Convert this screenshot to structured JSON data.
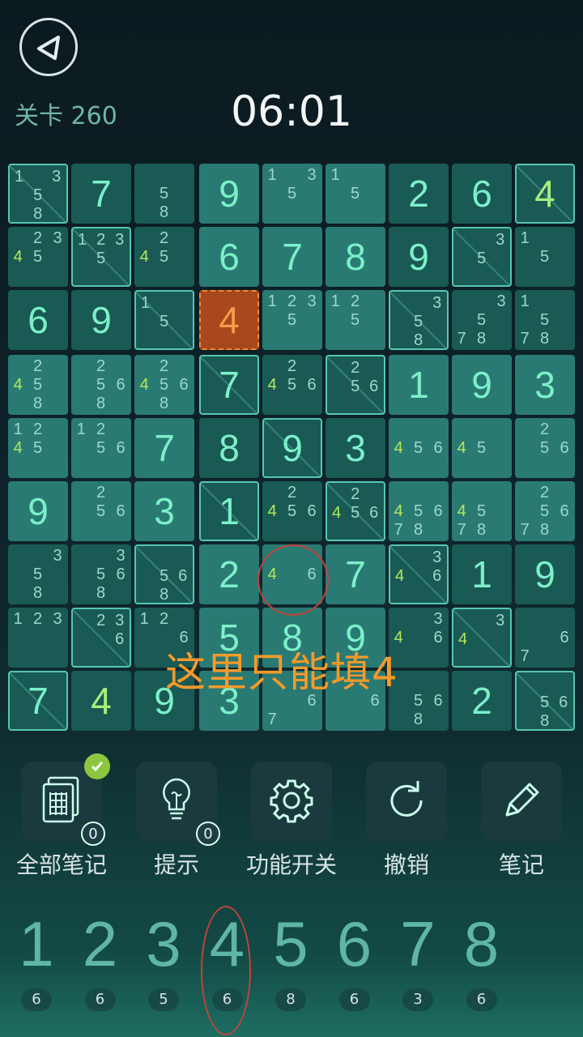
{
  "header": {
    "level_label": "关卡 260",
    "timer": "06:01"
  },
  "overlay_hint": "这里只能填4",
  "board": [
    [
      {
        "n": [
          "1",
          "",
          "3",
          "",
          "5",
          "",
          "",
          "8",
          ""
        ],
        "f": 1
      },
      {
        "v": "7"
      },
      {
        "n": [
          "",
          "",
          "",
          "",
          "5",
          "",
          "",
          "8",
          ""
        ]
      },
      {
        "v": "9"
      },
      {
        "n": [
          "1",
          "",
          "3",
          "",
          "5",
          "",
          "",
          "",
          ""
        ]
      },
      {
        "n": [
          "1",
          "",
          "",
          "",
          "5",
          "",
          "",
          "",
          ""
        ]
      },
      {
        "v": "2"
      },
      {
        "v": "6"
      },
      {
        "v": "4",
        "c": "green",
        "f": 1
      }
    ],
    [
      {
        "n": [
          "",
          "2",
          "3",
          "4",
          "5",
          "",
          "",
          "",
          ""
        ],
        "g": [
          3
        ]
      },
      {
        "n": [
          "1",
          "2",
          "3",
          "",
          "5",
          "",
          "",
          "",
          ""
        ],
        "f": 1
      },
      {
        "n": [
          "",
          "2",
          "",
          "4",
          "5",
          "",
          "",
          "",
          ""
        ],
        "g": [
          3
        ]
      },
      {
        "v": "6"
      },
      {
        "v": "7"
      },
      {
        "v": "8"
      },
      {
        "v": "9"
      },
      {
        "n": [
          "",
          "",
          "3",
          "",
          "5",
          "",
          "",
          "",
          ""
        ],
        "f": 1
      },
      {
        "n": [
          "1",
          "",
          "",
          "",
          "5",
          "",
          "",
          "",
          ""
        ]
      }
    ],
    [
      {
        "v": "6"
      },
      {
        "v": "9"
      },
      {
        "n": [
          "1",
          "",
          "",
          "",
          "5",
          "",
          "",
          "",
          ""
        ],
        "f": 1
      },
      {
        "v": "4",
        "c": "orange",
        "sel": 1
      },
      {
        "n": [
          "1",
          "2",
          "3",
          "",
          "5",
          "",
          "",
          "",
          ""
        ]
      },
      {
        "n": [
          "1",
          "2",
          "",
          "",
          "5",
          "",
          "",
          "",
          ""
        ]
      },
      {
        "n": [
          "",
          "",
          "3",
          "",
          "5",
          "",
          "",
          "8",
          ""
        ],
        "f": 1
      },
      {
        "n": [
          "",
          "",
          "3",
          "",
          "5",
          "",
          "7",
          "8",
          ""
        ]
      },
      {
        "n": [
          "1",
          "",
          "",
          "",
          "5",
          "",
          "7",
          "8",
          ""
        ]
      }
    ],
    [
      {
        "n": [
          "",
          "2",
          "",
          "4",
          "5",
          "",
          "",
          "8",
          ""
        ],
        "g": [
          3
        ]
      },
      {
        "n": [
          "",
          "2",
          "",
          "",
          "5",
          "6",
          "",
          "8",
          ""
        ]
      },
      {
        "n": [
          "",
          "2",
          "",
          "4",
          "5",
          "6",
          "",
          "8",
          ""
        ],
        "g": [
          3
        ]
      },
      {
        "v": "7",
        "f": 1
      },
      {
        "n": [
          "",
          "2",
          "",
          "4",
          "5",
          "6",
          "",
          "",
          ""
        ],
        "g": [
          3
        ]
      },
      {
        "n": [
          "",
          "2",
          "",
          "",
          "5",
          "6",
          "",
          "",
          ""
        ],
        "f": 1
      },
      {
        "v": "1"
      },
      {
        "v": "9"
      },
      {
        "v": "3"
      }
    ],
    [
      {
        "n": [
          "1",
          "2",
          "",
          "4",
          "5",
          "",
          "",
          "",
          ""
        ],
        "g": [
          3
        ]
      },
      {
        "n": [
          "1",
          "2",
          "",
          "",
          "5",
          "6",
          "",
          "",
          ""
        ]
      },
      {
        "v": "7"
      },
      {
        "v": "8"
      },
      {
        "v": "9",
        "f": 1
      },
      {
        "v": "3"
      },
      {
        "n": [
          "",
          "",
          "",
          "4",
          "5",
          "6",
          "",
          "",
          ""
        ],
        "g": [
          3
        ]
      },
      {
        "n": [
          "",
          "",
          "",
          "4",
          "5",
          "",
          "",
          "",
          ""
        ],
        "g": [
          3
        ]
      },
      {
        "n": [
          "",
          "2",
          "",
          "",
          "5",
          "6",
          "",
          "",
          ""
        ]
      }
    ],
    [
      {
        "v": "9"
      },
      {
        "n": [
          "",
          "2",
          "",
          "",
          "5",
          "6",
          "",
          "",
          ""
        ]
      },
      {
        "v": "3"
      },
      {
        "v": "1",
        "f": 1
      },
      {
        "n": [
          "",
          "2",
          "",
          "4",
          "5",
          "6",
          "",
          "",
          ""
        ],
        "g": [
          3
        ]
      },
      {
        "n": [
          "",
          "2",
          "",
          "4",
          "5",
          "6",
          "",
          "",
          ""
        ],
        "g": [
          3
        ],
        "f": 1
      },
      {
        "n": [
          "",
          "",
          "",
          "4",
          "5",
          "6",
          "7",
          "8",
          ""
        ],
        "g": [
          3
        ]
      },
      {
        "n": [
          "",
          "",
          "",
          "4",
          "5",
          "",
          "7",
          "8",
          ""
        ],
        "g": [
          3
        ]
      },
      {
        "n": [
          "",
          "2",
          "",
          "",
          "5",
          "6",
          "7",
          "8",
          ""
        ]
      }
    ],
    [
      {
        "n": [
          "",
          "",
          "3",
          "",
          "5",
          "",
          "",
          "8",
          ""
        ]
      },
      {
        "n": [
          "",
          "",
          "3",
          "",
          "5",
          "6",
          "",
          "8",
          ""
        ]
      },
      {
        "n": [
          "",
          "",
          "",
          "",
          "5",
          "6",
          "",
          "8",
          ""
        ],
        "f": 1
      },
      {
        "v": "2"
      },
      {
        "n": [
          "",
          "",
          "",
          "4",
          "",
          "6",
          "",
          "",
          ""
        ],
        "g": [
          3
        ]
      },
      {
        "v": "7"
      },
      {
        "n": [
          "",
          "",
          "3",
          "4",
          "",
          "6",
          "",
          "",
          ""
        ],
        "g": [
          3
        ],
        "f": 1
      },
      {
        "v": "1"
      },
      {
        "v": "9"
      }
    ],
    [
      {
        "n": [
          "1",
          "2",
          "3",
          "",
          "",
          "",
          "",
          "",
          ""
        ]
      },
      {
        "n": [
          "",
          "2",
          "3",
          "",
          "",
          "6",
          "",
          "",
          ""
        ],
        "f": 1
      },
      {
        "n": [
          "1",
          "2",
          "",
          "",
          "",
          "6",
          "",
          "",
          ""
        ]
      },
      {
        "v": "5"
      },
      {
        "v": "8"
      },
      {
        "v": "9"
      },
      {
        "n": [
          "",
          "",
          "3",
          "4",
          "",
          "6",
          "",
          "",
          ""
        ],
        "g": [
          3
        ]
      },
      {
        "n": [
          "",
          "",
          "3",
          "4",
          "",
          "",
          "",
          "",
          ""
        ],
        "g": [
          3
        ],
        "f": 1
      },
      {
        "n": [
          "",
          "",
          "",
          "",
          "",
          "6",
          "7",
          "",
          ""
        ]
      }
    ],
    [
      {
        "v": "7",
        "f": 1
      },
      {
        "v": "4",
        "c": "green"
      },
      {
        "v": "9"
      },
      {
        "v": "3"
      },
      {
        "n": [
          "",
          "",
          "",
          "",
          "",
          "6",
          "7",
          "",
          ""
        ]
      },
      {
        "n": [
          "",
          "",
          "",
          "",
          "",
          "6",
          "",
          "",
          ""
        ]
      },
      {
        "n": [
          "",
          "",
          "",
          "",
          "5",
          "6",
          "",
          "8",
          ""
        ]
      },
      {
        "v": "2"
      },
      {
        "n": [
          "",
          "",
          "",
          "",
          "5",
          "6",
          "",
          "8",
          ""
        ],
        "f": 1
      }
    ]
  ],
  "tools": [
    {
      "label": "全部笔记",
      "icon": "notes-grid-icon",
      "count": "0",
      "checked": true
    },
    {
      "label": "提示",
      "icon": "lightbulb-icon",
      "count": "0"
    },
    {
      "label": "功能开关",
      "icon": "gear-icon"
    },
    {
      "label": "撤销",
      "icon": "undo-icon"
    },
    {
      "label": "笔记",
      "icon": "pencil-icon"
    }
  ],
  "numpad": [
    {
      "digit": "1",
      "count": "6"
    },
    {
      "digit": "2",
      "count": "6"
    },
    {
      "digit": "3",
      "count": "5"
    },
    {
      "digit": "4",
      "count": "6"
    },
    {
      "digit": "5",
      "count": "8"
    },
    {
      "digit": "6",
      "count": "6"
    },
    {
      "digit": "7",
      "count": "3"
    },
    {
      "digit": "8",
      "count": "6"
    }
  ]
}
